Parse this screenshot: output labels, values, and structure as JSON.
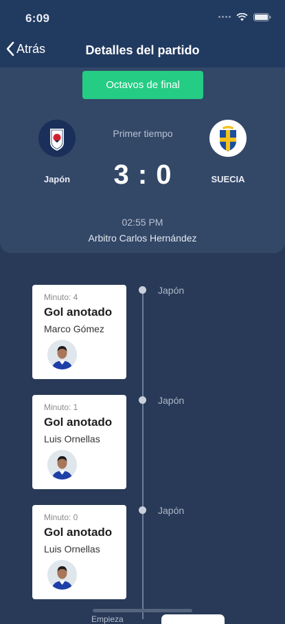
{
  "status_bar": {
    "time": "6:09"
  },
  "nav": {
    "back_label": "Atrás",
    "title": "Detalles del partido"
  },
  "match": {
    "stage": "Octavos de final",
    "home_team": "Japón",
    "away_team": "SUECIA",
    "period": "Primer tiempo",
    "score": "3 : 0",
    "time": "02:55 PM",
    "referee": "Arbitro Carlos Hernández"
  },
  "events": [
    {
      "minute": "Minuto: 4",
      "title": "Gol anotado",
      "player": "Marco Gómez",
      "team": "Japón"
    },
    {
      "minute": "Minuto: 1",
      "title": "Gol anotado",
      "player": "Luis Ornellas",
      "team": "Japón"
    },
    {
      "minute": "Minuto: 0",
      "title": "Gol anotado",
      "player": "Luis Ornellas",
      "team": "Japón"
    }
  ],
  "footer": {
    "partial_label": "Empieza"
  },
  "colors": {
    "accent": "#25cc84",
    "nav_bg": "#213a5f",
    "card_bg": "#334767",
    "page_bg": "#283a57"
  }
}
